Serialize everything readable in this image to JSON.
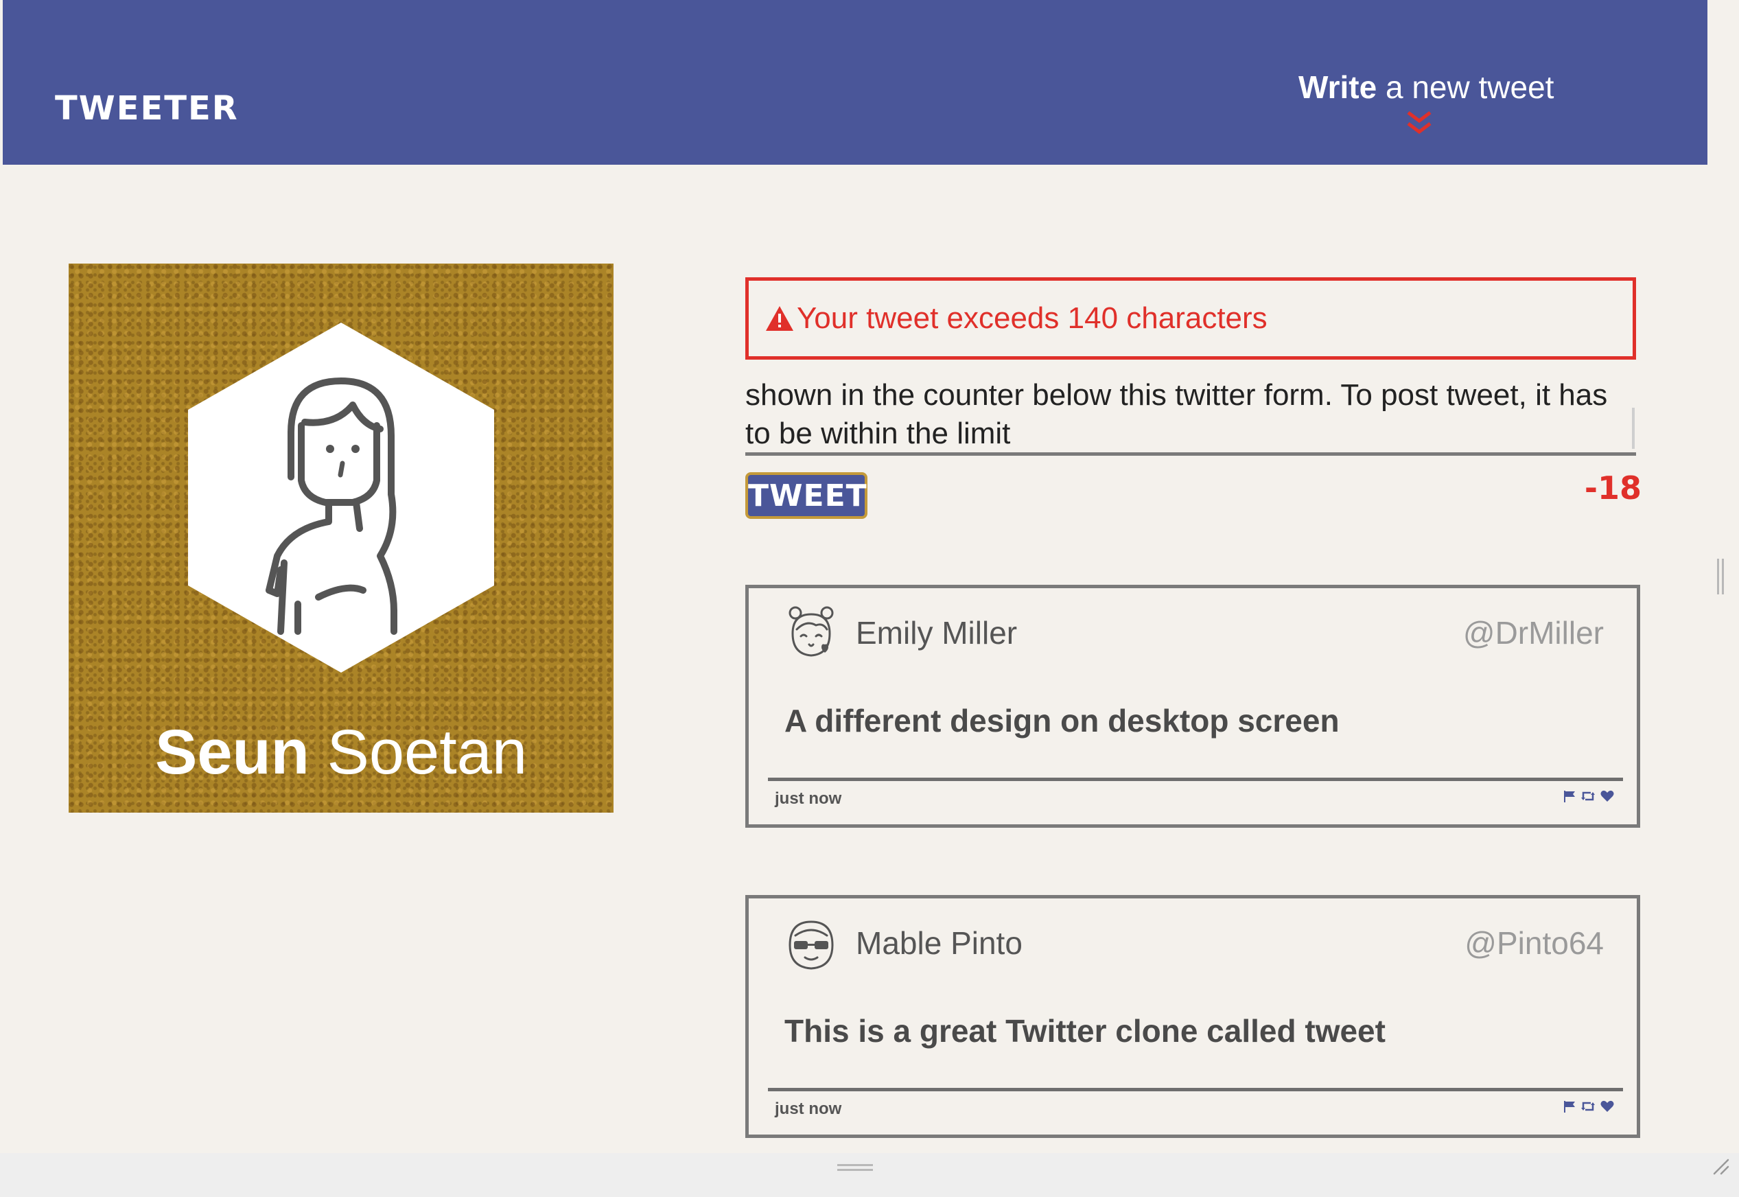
{
  "nav": {
    "brand": "Tweeter",
    "write_bold": "Write",
    "write_rest": " a new tweet",
    "chevron_icon": "double-chevron-down-icon"
  },
  "profile": {
    "first_name": "Seun",
    "last_name": "Soetan",
    "avatar_icon": "woman-avatar-icon"
  },
  "composer": {
    "error_message": "Your tweet exceeds 140 characters",
    "error_icon": "warning-triangle-icon",
    "textarea_value": "shown in the counter below this twitter form. To post tweet, it has to be within the limit",
    "button_label": "TWEET",
    "counter": "-18"
  },
  "tweets": [
    {
      "name": "Emily Miller",
      "handle": "@DrMiller",
      "content": "A different design on desktop screen",
      "time": "just now",
      "avatar_icon": "girl-avatar-icon"
    },
    {
      "name": "Mable Pinto",
      "handle": "@Pinto64",
      "content": "This is a great Twitter clone called tweet",
      "time": "just now",
      "avatar_icon": "sunglasses-avatar-icon"
    }
  ],
  "colors": {
    "nav_bg": "#4a5699",
    "page_bg": "#f4f1ec",
    "error": "#e0302a",
    "profile_bg": "#ab8427",
    "border_gray": "#7a7a7a"
  }
}
